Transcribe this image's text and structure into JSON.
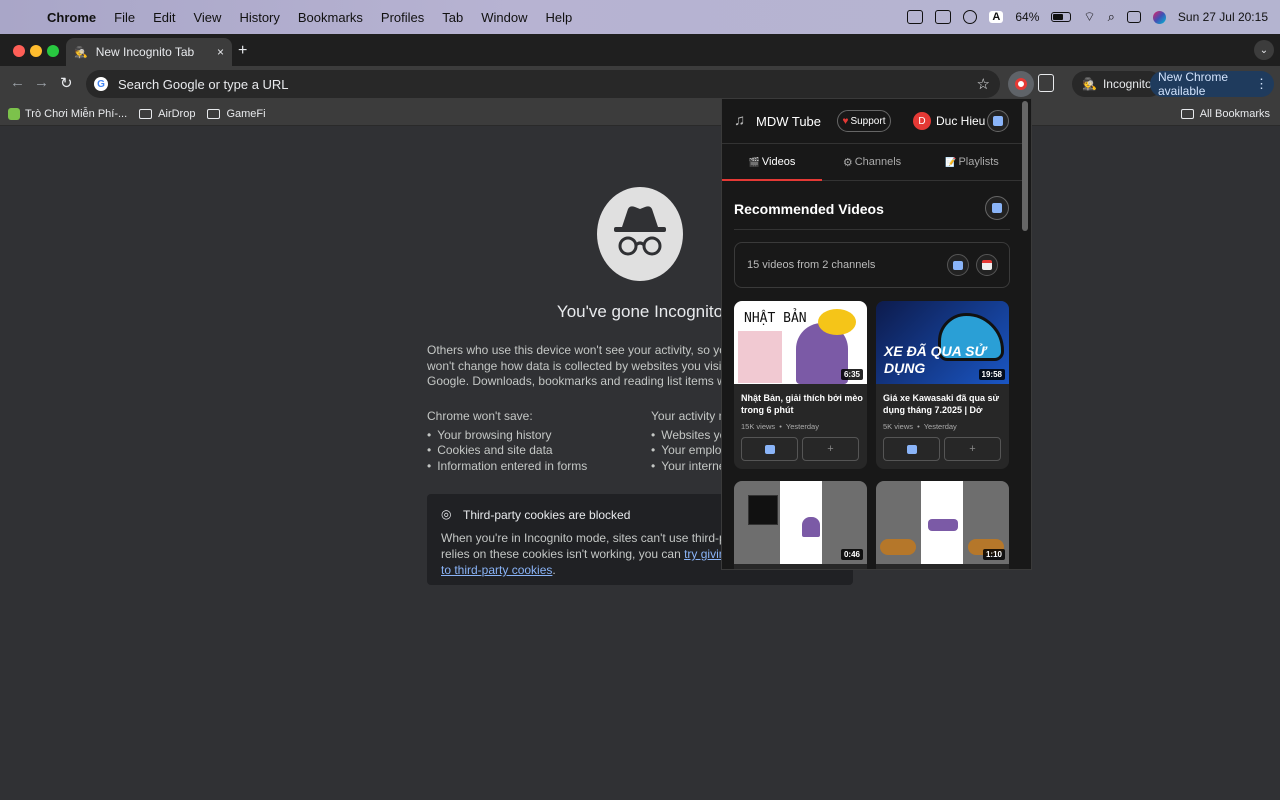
{
  "menubar": {
    "app": "Chrome",
    "items": [
      "File",
      "Edit",
      "View",
      "History",
      "Bookmarks",
      "Profiles",
      "Tab",
      "Window",
      "Help"
    ],
    "battery_percent": "64%",
    "battery_level": 0.64,
    "datetime": "Sun 27 Jul  20:15",
    "input_source": "A"
  },
  "tab": {
    "title": "New Incognito Tab",
    "close": "×",
    "new_tab": "+"
  },
  "toolbar": {
    "back": "←",
    "forward": "→",
    "reload": "↻",
    "omnibox_placeholder": "Search Google or type a URL",
    "incognito_label": "Incognito",
    "update_label": "New Chrome available",
    "more": "⋮",
    "star": "☆"
  },
  "bookmarks": {
    "items": [
      "Trò Chơi Miễn Phí-...",
      "AirDrop",
      "GameFi"
    ],
    "all": "All Bookmarks"
  },
  "incognito": {
    "title": "You've gone Incognito",
    "intro": [
      "Others who use this device won't see your activity, so you can br",
      "won't change how data is collected by websites you visit and the",
      "Google. Downloads, bookmarks and reading list items will be sav"
    ],
    "wont_save_title": "Chrome won't save:",
    "wont_save": [
      "Your browsing history",
      "Cookies and site data",
      "Information entered in forms"
    ],
    "visible_title": "Your activity mi",
    "visible": [
      "Websites you",
      "Your employe",
      "Your internet"
    ],
    "cookies_title": "Third-party cookies are blocked",
    "cookies_line1": "When you're in Incognito mode, sites can't use third-party co",
    "cookies_line2_prefix": "relies on these cookies isn't working, you can ",
    "cookies_link1": "try giving that s",
    "cookies_link2": "to third-party cookies",
    "cookies_end": "."
  },
  "popup": {
    "app_name": "MDW Tube",
    "support_label": "Support",
    "avatar_letter": "D",
    "user_name": "Duc Hieu",
    "tabs": [
      "Videos",
      "Channels",
      "Playlists"
    ],
    "tab_icons": [
      "🎬",
      "⚙",
      "📝"
    ],
    "section_title": "Recommended Videos",
    "summary": "15 videos from 2 channels",
    "videos": [
      {
        "title": "Nhật Bản, giải thích bởi mèo trong 6 phút",
        "views": "15K views",
        "date": "Yesterday",
        "duration": "6:35",
        "thumb_text": "NHẬT BẢN"
      },
      {
        "title": "Giá xe Kawasaki đã qua sử dụng tháng 7.2025 | Dở",
        "views": "5K views",
        "date": "Yesterday",
        "duration": "19:58",
        "thumb_text": "XE ĐÃ QUA SỬ DỤNG"
      },
      {
        "title": "",
        "views": "",
        "date": "",
        "duration": "0:46",
        "thumb_text": ""
      },
      {
        "title": "",
        "views": "",
        "date": "",
        "duration": "1:10",
        "thumb_text": ""
      }
    ],
    "meta_sep": "•",
    "add_label": "+"
  },
  "colors": {
    "accent": "#e53935",
    "link": "#8ab4f8",
    "update_chip": "#1f3b5d"
  }
}
